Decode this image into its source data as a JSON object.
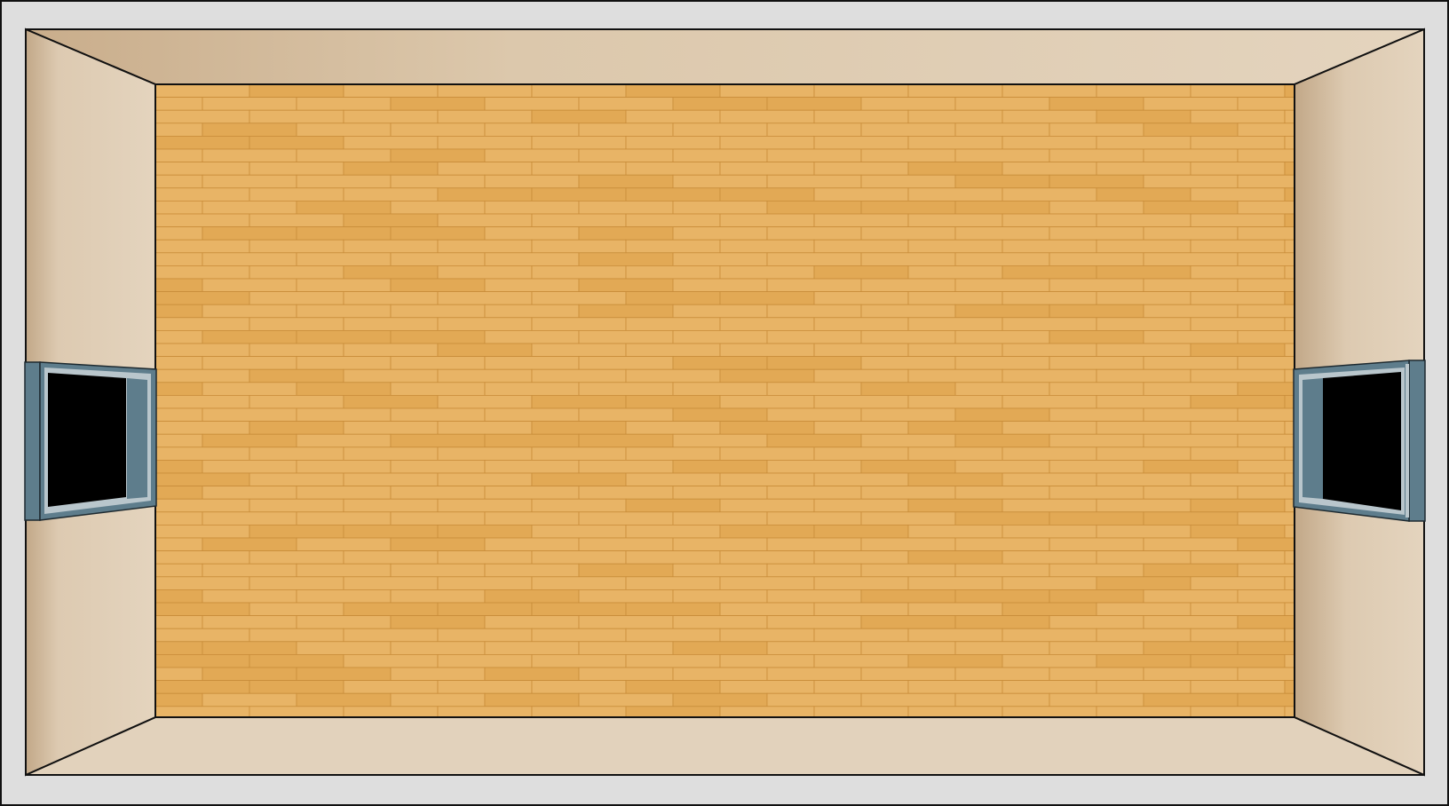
{
  "scene": {
    "kind": "room-top-view",
    "walls": {
      "outer_frame": "#dedede",
      "wall_light": "#e2d2bc",
      "wall_dark": "#ccb294",
      "outline": "#111111"
    },
    "floor": {
      "material": "wood-planks",
      "colors": {
        "plank": "#e8b466",
        "plank_alt": "#e2a955",
        "seam": "#c98d3a"
      }
    },
    "windows": [
      {
        "side": "left",
        "state": "open"
      },
      {
        "side": "right",
        "state": "open"
      }
    ],
    "window_colors": {
      "frame": "#5e7d8c",
      "frame_dark": "#3f5662",
      "glass_edge": "#b9c6cc",
      "opening": "#000000"
    }
  }
}
